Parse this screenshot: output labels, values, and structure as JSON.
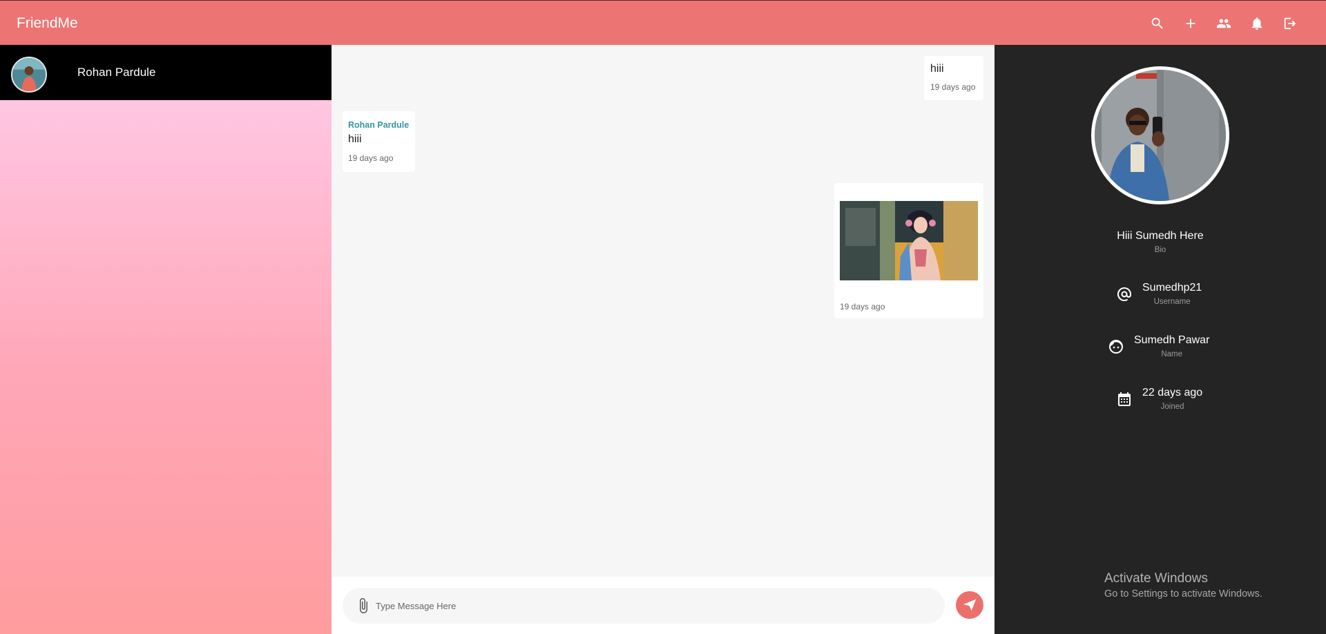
{
  "app": {
    "brand": "FriendMe",
    "accent_color": "#ec7472"
  },
  "header": {
    "icons": [
      "search-icon",
      "add-icon",
      "people-icon",
      "bell-icon",
      "logout-icon"
    ]
  },
  "sidebar": {
    "contacts": [
      {
        "name": "Rohan Pardule",
        "avatar": "avatar-image"
      }
    ]
  },
  "chat": {
    "messages": [
      {
        "side": "right",
        "text": "hiii",
        "time": "19 days ago"
      },
      {
        "side": "left",
        "sender": "Rohan Pardule",
        "text": "hiii",
        "time": "19 days ago"
      },
      {
        "side": "right",
        "type": "image",
        "image": "anime-girl-headphones-image",
        "time": "19 days ago"
      }
    ],
    "composer": {
      "placeholder": "Type Message Here",
      "attach_icon": "paperclip-icon",
      "send_icon": "send-icon",
      "send_color": "#ec6f6c"
    }
  },
  "profile": {
    "bio": {
      "value": "Hiii Sumedh Here",
      "label": "Bio"
    },
    "username": {
      "value": "Sumedhp21",
      "label": "Username",
      "icon": "at-icon"
    },
    "name": {
      "value": "Sumedh Pawar",
      "label": "Name",
      "icon": "face-icon"
    },
    "joined": {
      "value": "22 days ago",
      "label": "Joined",
      "icon": "calendar-icon"
    }
  },
  "watermark": {
    "line1": "Activate Windows",
    "line2": "Go to Settings to activate Windows."
  }
}
